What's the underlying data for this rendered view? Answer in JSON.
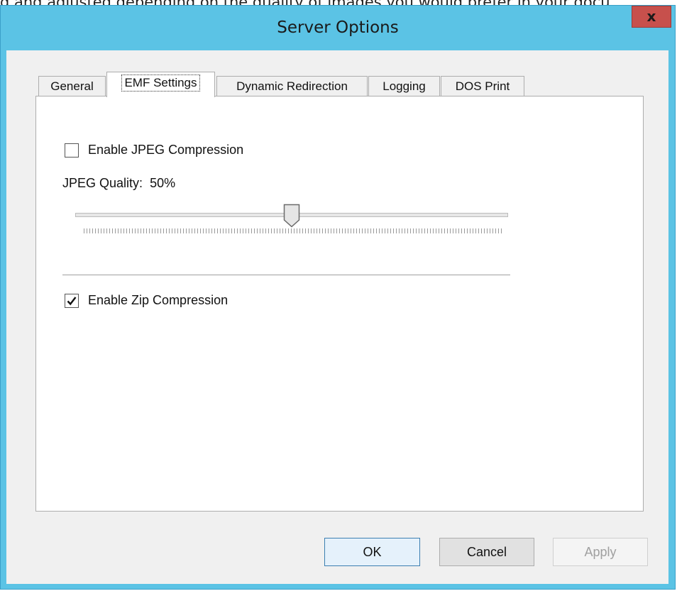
{
  "background_text": "d and adjusted depending on the quality of images you would prefer in your docu",
  "window": {
    "title": "Server Options",
    "close_label": "x"
  },
  "tabs": [
    {
      "label": "General",
      "active": false
    },
    {
      "label": "EMF Settings",
      "active": true
    },
    {
      "label": "Dynamic Redirection",
      "active": false
    },
    {
      "label": "Logging",
      "active": false
    },
    {
      "label": "DOS Print",
      "active": false
    }
  ],
  "emf": {
    "jpeg_compression": {
      "label": "Enable JPEG Compression",
      "checked": false
    },
    "jpeg_quality": {
      "label": "JPEG Quality:",
      "value_text": "50%",
      "value": 50
    },
    "zip_compression": {
      "label": "Enable Zip Compression",
      "checked": true
    }
  },
  "buttons": {
    "ok": "OK",
    "cancel": "Cancel",
    "apply": "Apply"
  },
  "colors": {
    "titlebar": "#5bc3e5",
    "close_button": "#c7504c",
    "dialog": "#f0f0f0",
    "panel": "#ffffff"
  }
}
